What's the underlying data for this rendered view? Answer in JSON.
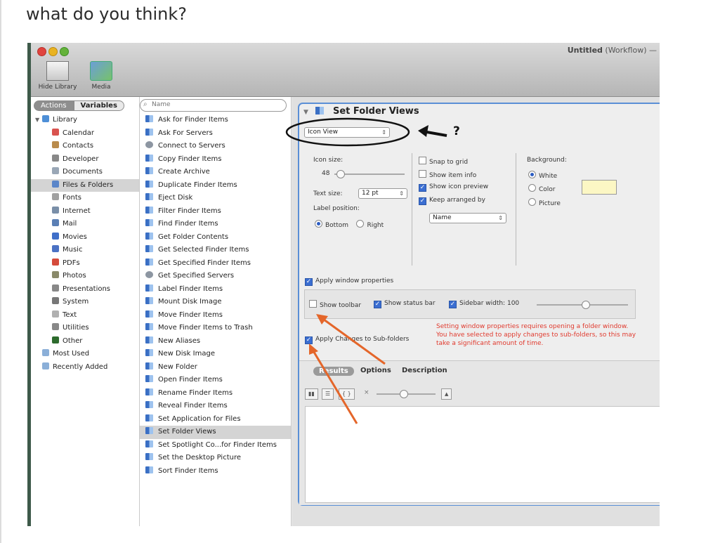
{
  "post": {
    "question": "what do you think?"
  },
  "window": {
    "title_bold": "Untitled",
    "title_rest": "(Workflow) —",
    "toolbar": {
      "hide_library": "Hide Library",
      "media": "Media"
    }
  },
  "library": {
    "tabs": {
      "actions": "Actions",
      "variables": "Variables"
    },
    "items": [
      {
        "label": "Library",
        "color": "#4e8fd7",
        "root": true
      },
      {
        "label": "Calendar",
        "color": "#d9534f"
      },
      {
        "label": "Contacts",
        "color": "#b98b4c"
      },
      {
        "label": "Developer",
        "color": "#888888"
      },
      {
        "label": "Documents",
        "color": "#9aa7b6"
      },
      {
        "label": "Files & Folders",
        "color": "#5b86c9",
        "selected": true
      },
      {
        "label": "Fonts",
        "color": "#a0a0a0"
      },
      {
        "label": "Internet",
        "color": "#7a8fa8"
      },
      {
        "label": "Mail",
        "color": "#5a7fb5"
      },
      {
        "label": "Movies",
        "color": "#3f6fc9"
      },
      {
        "label": "Music",
        "color": "#4b72c4"
      },
      {
        "label": "PDFs",
        "color": "#d54b3b"
      },
      {
        "label": "Photos",
        "color": "#8a8a6a"
      },
      {
        "label": "Presentations",
        "color": "#888888"
      },
      {
        "label": "System",
        "color": "#777777"
      },
      {
        "label": "Text",
        "color": "#b0b0b0"
      },
      {
        "label": "Utilities",
        "color": "#888888"
      },
      {
        "label": "Other",
        "color": "#2d6b2d"
      },
      {
        "label": "Most Used",
        "color": "#8bafd8",
        "folder": true
      },
      {
        "label": "Recently Added",
        "color": "#8bafd8",
        "folder": true
      }
    ]
  },
  "actions": {
    "search_placeholder": "Name",
    "items": [
      {
        "label": "Ask for Finder Items"
      },
      {
        "label": "Ask For Servers"
      },
      {
        "label": "Connect to Servers",
        "server": true
      },
      {
        "label": "Copy Finder Items"
      },
      {
        "label": "Create Archive"
      },
      {
        "label": "Duplicate Finder Items"
      },
      {
        "label": "Eject Disk"
      },
      {
        "label": "Filter Finder Items"
      },
      {
        "label": "Find Finder Items"
      },
      {
        "label": "Get Folder Contents"
      },
      {
        "label": "Get Selected Finder Items"
      },
      {
        "label": "Get Specified Finder Items"
      },
      {
        "label": "Get Specified Servers",
        "server": true
      },
      {
        "label": "Label Finder Items"
      },
      {
        "label": "Mount Disk Image"
      },
      {
        "label": "Move Finder Items"
      },
      {
        "label": "Move Finder Items to Trash"
      },
      {
        "label": "New Aliases"
      },
      {
        "label": "New Disk Image"
      },
      {
        "label": "New Folder"
      },
      {
        "label": "Open Finder Items"
      },
      {
        "label": "Rename Finder Items"
      },
      {
        "label": "Reveal Finder Items"
      },
      {
        "label": "Set Application for Files"
      },
      {
        "label": "Set Folder Views",
        "selected": true
      },
      {
        "label": "Set Spotlight Co...for Finder Items"
      },
      {
        "label": "Set the Desktop Picture"
      },
      {
        "label": "Sort Finder Items"
      }
    ]
  },
  "panel": {
    "title": "Set Folder Views",
    "view_popup": "Icon View",
    "icon_size_label": "Icon size:",
    "icon_size_value": "48",
    "icon_size_level": 0.08,
    "text_size_label": "Text size:",
    "text_size_value": "12 pt",
    "label_position_label": "Label position:",
    "label_bottom": "Bottom",
    "label_right": "Right",
    "snap_to_grid": "Snap to grid",
    "show_item_info": "Show item info",
    "show_icon_preview": "Show icon preview",
    "keep_arranged_by": "Keep arranged by",
    "arrange_popup": "Name",
    "background_label": "Background:",
    "bg_white": "White",
    "bg_color": "Color",
    "bg_picture": "Picture",
    "bg_color_swatch": "#fcf7c4",
    "apply_window_properties": "Apply window properties",
    "show_toolbar": "Show toolbar",
    "show_status_bar": "Show status bar",
    "sidebar_width_label": "Sidebar width:",
    "sidebar_width_value": "100",
    "sidebar_width_level": 0.53,
    "apply_subfolders": "Apply Changes to Sub-folders",
    "warning": "Setting window properties requires opening a folder window. You have selected to apply changes to sub-folders, so this may take a significant amount of time.",
    "tabs": {
      "results": "Results",
      "options": "Options",
      "description": "Description"
    },
    "results_zoom_level": 0.45
  },
  "annotations": {
    "question_mark": "?"
  },
  "colors": {
    "accent": "#5a8fd6",
    "warning": "#e03a2e",
    "annotation_orange": "#e4662a"
  }
}
